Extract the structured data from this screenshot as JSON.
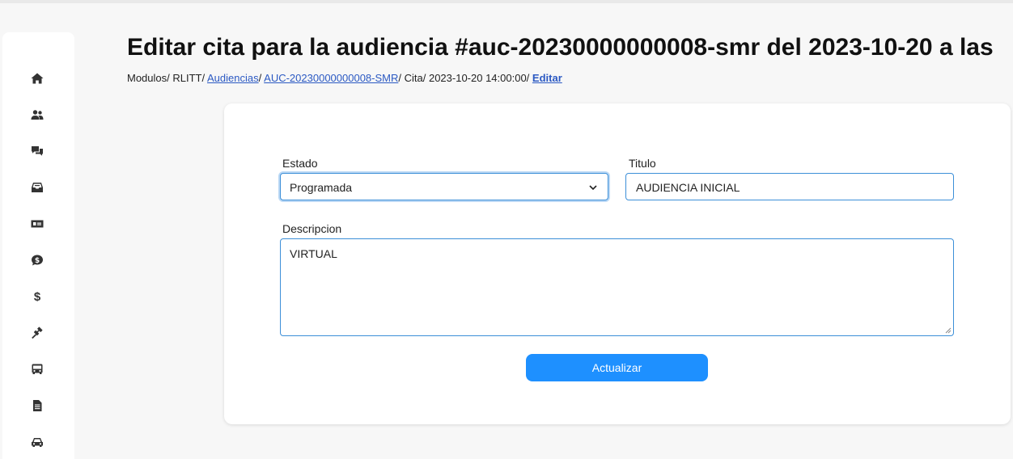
{
  "header": {
    "title": "Editar cita para la audiencia #auc-20230000000008-smr del 2023-10-20 a las"
  },
  "breadcrumb": {
    "modulos": "Modulos/",
    "rlitt": "RLITT/",
    "audiencias": "Audiencias",
    "sep1": "/",
    "case_id": "AUC-20230000000008-SMR",
    "cita": "/ Cita/",
    "datetime": "2023-10-20 14:00:00/",
    "editar": "Editar"
  },
  "sidebar": {
    "icons": [
      "home-icon",
      "users-icon",
      "chat-icon",
      "inbox-icon",
      "money-bill-icon",
      "comment-dollar-icon",
      "dollar-icon",
      "gavel-icon",
      "bus-icon",
      "document-icon",
      "car-icon"
    ]
  },
  "form": {
    "estado_label": "Estado",
    "estado_value": "Programada",
    "titulo_label": "Titulo",
    "titulo_value": "AUDIENCIA INICIAL",
    "descripcion_label": "Descripcion",
    "descripcion_value": "VIRTUAL",
    "submit_label": "Actualizar"
  },
  "colors": {
    "accent": "#1e90ff",
    "link": "#2b59c3",
    "field_border": "#3c8fd8"
  }
}
